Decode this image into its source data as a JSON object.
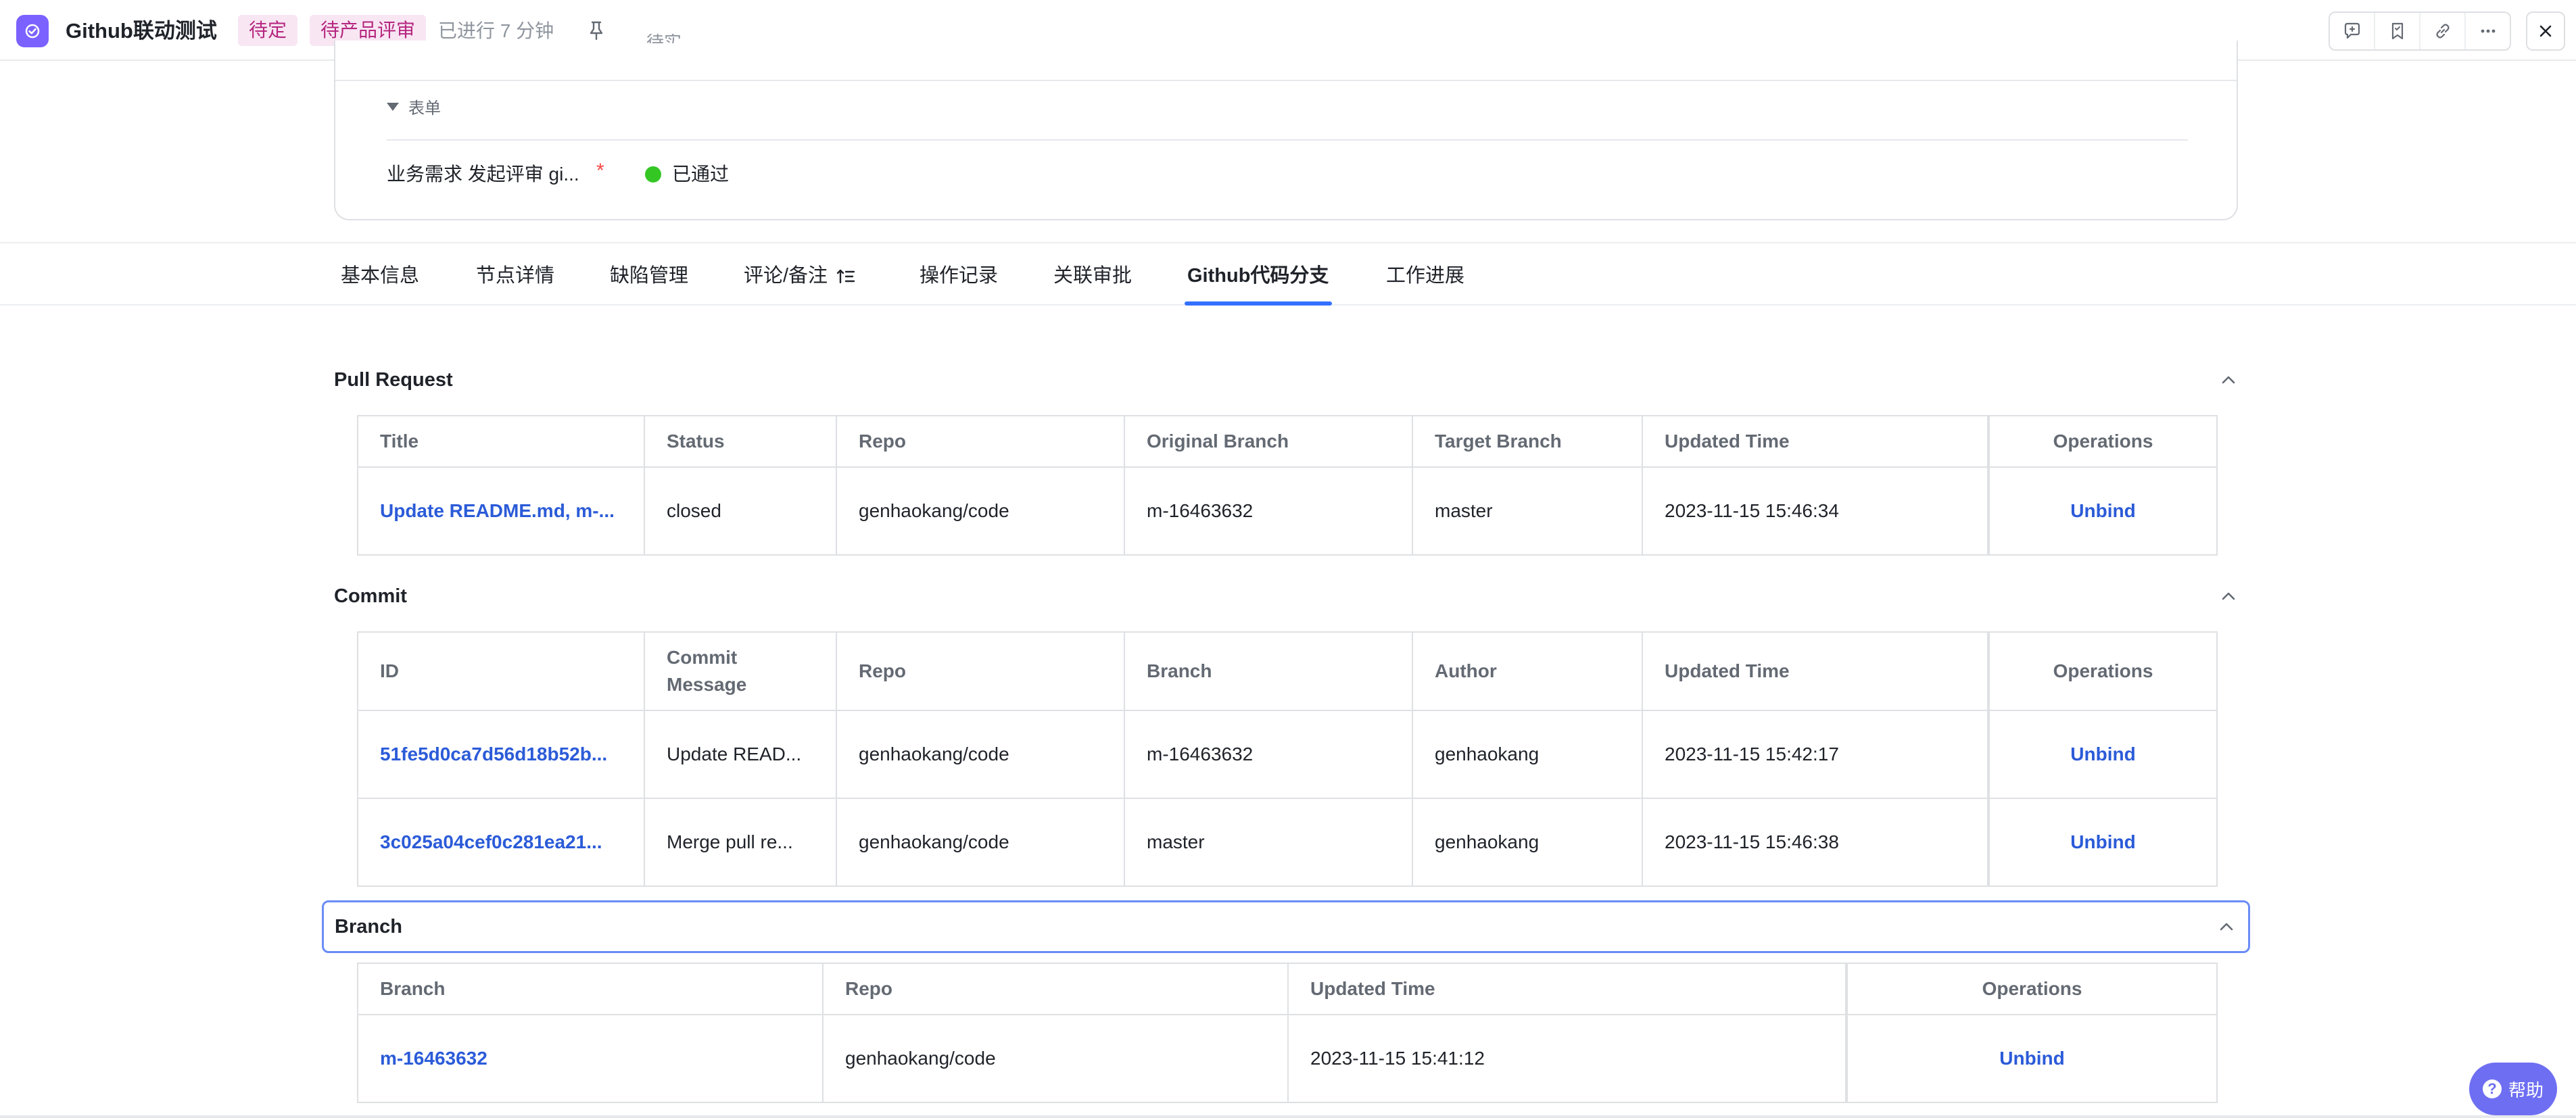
{
  "header": {
    "title": "Github联动测试",
    "tag_status": "待定",
    "tag_stage": "待产品评审",
    "elapsed": "已进行 7 分钟"
  },
  "form": {
    "cut_text": "待实",
    "toggle_label": "表单",
    "field_label": "业务需求 发起评审 gi...",
    "required_mark": "*",
    "status": "已通过"
  },
  "tabs": [
    "基本信息",
    "节点详情",
    "缺陷管理",
    "评论/备注",
    "操作记录",
    "关联审批",
    "Github代码分支",
    "工作进展"
  ],
  "pull_request": {
    "title": "Pull Request",
    "columns": [
      "Title",
      "Status",
      "Repo",
      "Original Branch",
      "Target Branch",
      "Updated Time",
      "Operations"
    ],
    "rows": [
      [
        "Update README.md, m-...",
        "closed",
        "genhaokang/code",
        "m-16463632",
        "master",
        "2023-11-15 15:46:34",
        "Unbind"
      ]
    ]
  },
  "commit": {
    "title": "Commit",
    "columns": [
      "ID",
      "Commit Message",
      "Repo",
      "Branch",
      "Author",
      "Updated Time",
      "Operations"
    ],
    "rows": [
      [
        "51fe5d0ca7d56d18b52b...",
        "Update READ...",
        "genhaokang/code",
        "m-16463632",
        "genhaokang",
        "2023-11-15 15:42:17",
        "Unbind"
      ],
      [
        "3c025a04cef0c281ea21...",
        "Merge pull re...",
        "genhaokang/code",
        "master",
        "genhaokang",
        "2023-11-15 15:46:38",
        "Unbind"
      ]
    ]
  },
  "branch": {
    "title": "Branch",
    "columns": [
      "Branch",
      "Repo",
      "Updated Time",
      "Operations"
    ],
    "rows": [
      [
        "m-16463632",
        "genhaokang/code",
        "2023-11-15 15:41:12",
        "Unbind"
      ]
    ]
  },
  "help": {
    "label": "帮助",
    "glyph": "?"
  },
  "colors": {
    "accent": "#7b61ff",
    "link": "#2b5bd8",
    "tag_bg": "#f8e6f3",
    "tag_text": "#b5267f",
    "passed": "#34c724",
    "tab_active": "#3370ff"
  },
  "icons": [
    "check-circle-icon",
    "pin-icon",
    "chat-add-icon",
    "bookmark-icon",
    "link-icon",
    "more-icon",
    "close-icon",
    "caret-down-icon",
    "sort-icon",
    "chevron-up-icon",
    "help-icon"
  ]
}
